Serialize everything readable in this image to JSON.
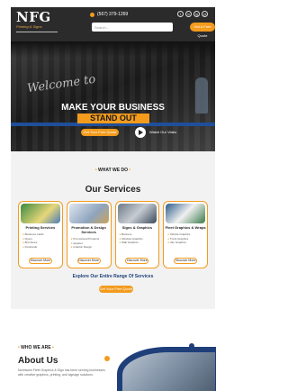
{
  "header": {
    "logo_text": "NFG",
    "logo_sub": "Printing & Signs",
    "phone": "(567) 379-1269",
    "search_placeholder": "Search...",
    "quote_button": "Get A Free Quote",
    "socials": [
      "f",
      "in",
      "ig",
      "yt"
    ]
  },
  "hero": {
    "script_text": "Welcome to",
    "title": "MAKE YOUR BUSINESS",
    "highlight": "STAND OUT",
    "cta_label": "Get Your Free Quote",
    "video_label": "Watch Our Video"
  },
  "services": {
    "kicker": "WHAT WE DO",
    "title": "Our Services",
    "cards": [
      {
        "title": "Printing Services",
        "items": [
          "Business Cards",
          "Flyers",
          "Brochures",
          "Postcards"
        ],
        "button": "Discover More"
      },
      {
        "title": "Promotion & Design Services",
        "items": [
          "Promotional Products",
          "Apparel",
          "Graphic Design"
        ],
        "button": "Discover More"
      },
      {
        "title": "Signs & Graphics",
        "items": [
          "Banners",
          "Window Graphics",
          "Wall Graphics"
        ],
        "button": "Discover More"
      },
      {
        "title": "Fleet Graphics & Wraps",
        "items": [
          "Vehicle Graphics",
          "Truck Graphics",
          "Van Graphics"
        ],
        "button": "Discover More"
      }
    ],
    "explore": "Explore Our Entire Range Of Services",
    "get_quote": "Get Your Free Quote"
  },
  "about": {
    "kicker": "WHO WE ARE",
    "title": "About Us",
    "text": "Northwest Fleet Graphics & Sign has been serving businesses with creative graphics, printing, and signage solutions."
  },
  "colors": {
    "accent": "#f39b1d",
    "brand_blue": "#1f3f7a",
    "dark": "#2b2b2b"
  }
}
